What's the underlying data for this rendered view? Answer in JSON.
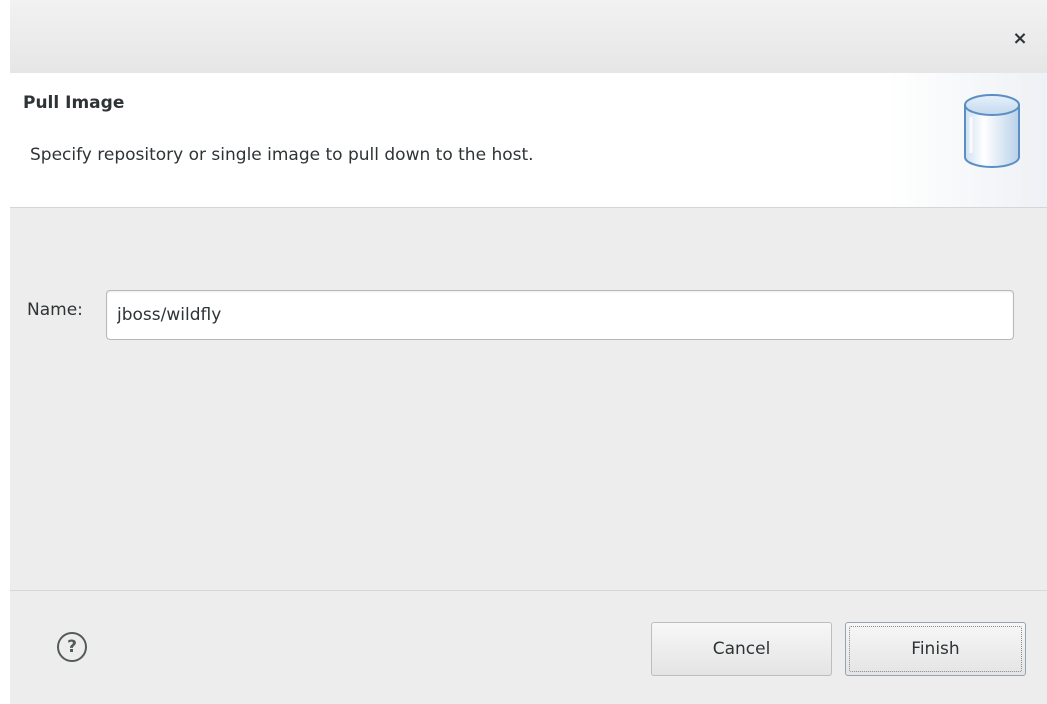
{
  "window": {
    "close_glyph": "×"
  },
  "banner": {
    "title": "Pull Image",
    "description": "Specify repository or single image to pull down to the host.",
    "icon": "database-cylinder-icon"
  },
  "form": {
    "name_label": "Name:",
    "name_value": "jboss/wildfly"
  },
  "footer": {
    "help_glyph": "?",
    "cancel_label": "Cancel",
    "finish_label": "Finish"
  },
  "colors": {
    "dialog_bg": "#ededed",
    "banner_bg": "#ffffff",
    "icon_blue": "#6a9fd0"
  }
}
